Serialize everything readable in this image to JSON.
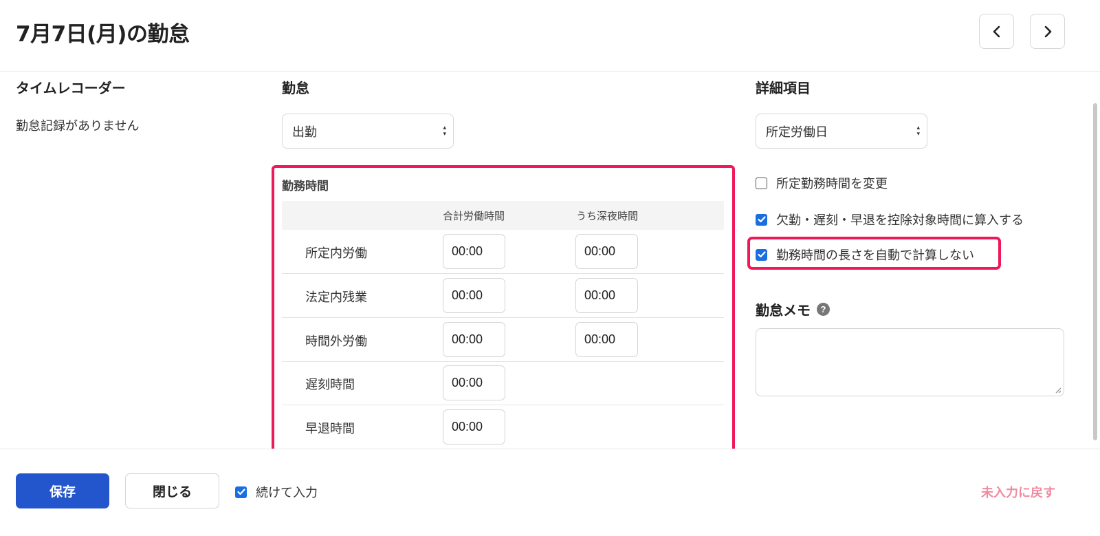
{
  "header": {
    "title": "7月7日(月)の勤怠",
    "prev_icon": "chevron-left-icon",
    "next_icon": "chevron-right-icon"
  },
  "timerecorder": {
    "title": "タイムレコーダー",
    "empty_text": "勤怠記録がありません"
  },
  "attendance": {
    "title": "勤怠",
    "select_value": "出勤",
    "work_time": {
      "section_title": "勤務時間",
      "col_total": "合計労働時間",
      "col_night": "うち深夜時間",
      "rows": [
        {
          "label": "所定内労働",
          "total": "00:00",
          "night": "00:00"
        },
        {
          "label": "法定内残業",
          "total": "00:00",
          "night": "00:00"
        },
        {
          "label": "時間外労働",
          "total": "00:00",
          "night": "00:00"
        },
        {
          "label": "遅刻時間",
          "total": "00:00"
        },
        {
          "label": "早退時間",
          "total": "00:00"
        }
      ]
    }
  },
  "details": {
    "title": "詳細項目",
    "select_value": "所定労働日",
    "checkboxes": [
      {
        "label": "所定勤務時間を変更",
        "checked": false
      },
      {
        "label": "欠勤・遅刻・早退を控除対象時間に算入する",
        "checked": true
      },
      {
        "label": "勤務時間の長さを自動で計算しない",
        "checked": true
      }
    ],
    "memo_title": "勤怠メモ",
    "memo_help": "?",
    "memo_value": ""
  },
  "colors": {
    "highlight": "#f0185a",
    "primary": "#2355cc",
    "checkbox": "#1a6fe0",
    "reset_link": "#f08aa0"
  },
  "footer": {
    "save_label": "保存",
    "close_label": "閉じる",
    "continue_label": "続けて入力",
    "continue_checked": true,
    "reset_label": "未入力に戻す"
  }
}
